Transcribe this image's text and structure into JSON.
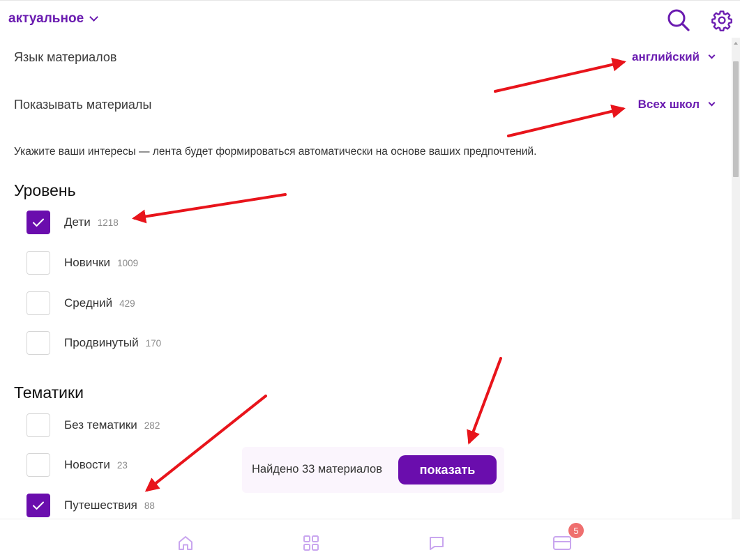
{
  "header": {
    "feed_label": "актуальное"
  },
  "settings": [
    {
      "name": "Язык материалов",
      "value": "английский"
    },
    {
      "name": "Показывать материалы",
      "value": "Всех школ"
    }
  ],
  "hint": "Укажите ваши интересы — лента будет формироваться автоматически на основе ваших предпочтений.",
  "level": {
    "title": "Уровень",
    "items": [
      {
        "label": "Дети",
        "count": "1218",
        "checked": true
      },
      {
        "label": "Новички",
        "count": "1009",
        "checked": false
      },
      {
        "label": "Средний",
        "count": "429",
        "checked": false
      },
      {
        "label": "Продвинутый",
        "count": "170",
        "checked": false
      }
    ]
  },
  "topics": {
    "title": "Тематики",
    "items": [
      {
        "label": "Без тематики",
        "count": "282",
        "checked": false
      },
      {
        "label": "Новости",
        "count": "23",
        "checked": false
      },
      {
        "label": "Путешествия",
        "count": "88",
        "checked": true
      }
    ]
  },
  "found": {
    "text": "Найдено 33 материалов",
    "button": "показать"
  },
  "bottom_nav": {
    "badge": "5",
    "icons": [
      "home-icon",
      "grid-icon",
      "chat-icon",
      "card-icon"
    ]
  },
  "colors": {
    "accent": "#6a0dad",
    "accent_text": "#6a1bb0",
    "badge": "#ef6f6f",
    "annotation_arrow": "#e8141b",
    "panel_bg": "#fbf5fd",
    "nav_icon": "#c9a6ef"
  }
}
